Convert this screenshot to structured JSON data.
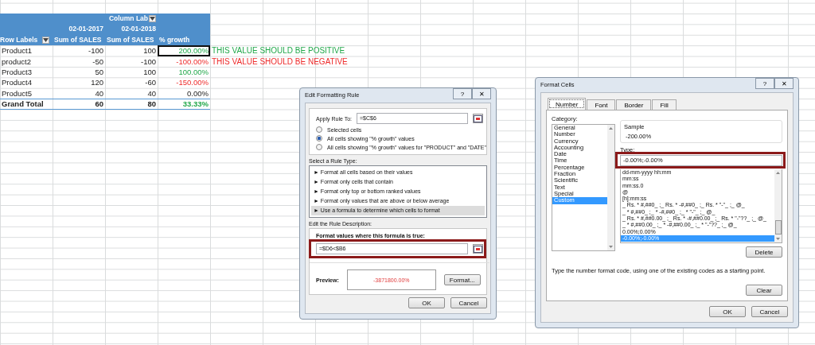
{
  "pivot": {
    "column_labels": "Column Lab",
    "dates": [
      "02-01-2017",
      "02-01-2018"
    ],
    "headers": [
      "Row Labels",
      "Sum of SALES",
      "Sum of SALES",
      "% growth"
    ],
    "rows": [
      {
        "label": "Product1",
        "sales_1": "-100",
        "sales_2": "100",
        "growth": "200.00%",
        "kind": "positive",
        "active": true,
        "note": {
          "text": "THIS VALUE SHOULD BE POSITIVE",
          "color": "#21a84a"
        }
      },
      {
        "label": "product2",
        "sales_1": "-50",
        "sales_2": "-100",
        "growth": "-100.00%",
        "kind": "negative",
        "active": false,
        "note": {
          "text": "THIS VALUE SHOULD BE NEGATIVE",
          "color": "#ee2a2a"
        }
      },
      {
        "label": "Product3",
        "sales_1": "50",
        "sales_2": "100",
        "growth": "100.00%",
        "kind": "positive",
        "active": false
      },
      {
        "label": "Product4",
        "sales_1": "120",
        "sales_2": "-60",
        "growth": "-150.00%",
        "kind": "negative",
        "active": false
      },
      {
        "label": "Product5",
        "sales_1": "40",
        "sales_2": "40",
        "growth": "0.00%",
        "kind": "zero",
        "active": false
      }
    ],
    "total": {
      "label": "Grand Total",
      "sales_1": "60",
      "sales_2": "80",
      "growth": "33.33%",
      "kind": "positive"
    }
  },
  "edit_rule_dialog": {
    "title": "Edit Formatting Rule",
    "title_buttons": [
      "?",
      "✕"
    ],
    "apply_label": "Apply Rule To:",
    "apply_value": "=$C$6",
    "scope_options": [
      {
        "label": "Selected cells",
        "selected": false
      },
      {
        "label": "All cells showing \"% growth\" values",
        "selected": true
      },
      {
        "label": "All cells showing \"% growth\" values for \"PRODUCT\" and \"DATE\"",
        "selected": false
      }
    ],
    "rule_type_label": "Select a Rule Type:",
    "rule_types": [
      {
        "label": "► Format all cells based on their values",
        "selected": false
      },
      {
        "label": "► Format only cells that contain",
        "selected": false
      },
      {
        "label": "► Format only top or bottom ranked values",
        "selected": false
      },
      {
        "label": "► Format only values that are above or below average",
        "selected": false
      },
      {
        "label": "► Use a formula to determine which cells to format",
        "selected": true
      }
    ],
    "description_label": "Edit the Rule Description:",
    "formula_label": "Format values where this formula is true:",
    "formula": "=$D6<$B6",
    "preview_label": "Preview:",
    "preview_value": "-3871800.00%",
    "format_button": "Format...",
    "buttons": [
      "OK",
      "Cancel"
    ]
  },
  "format_cells_dialog": {
    "title": "Format Cells",
    "title_buttons": [
      "?",
      "✕"
    ],
    "tabs": [
      {
        "label": "Number",
        "selected": true
      },
      {
        "label": "Font",
        "selected": false
      },
      {
        "label": "Border",
        "selected": false
      },
      {
        "label": "Fill",
        "selected": false
      }
    ],
    "category_label": "Category:",
    "categories": [
      {
        "label": "General",
        "selected": false
      },
      {
        "label": "Number",
        "selected": false
      },
      {
        "label": "Currency",
        "selected": false
      },
      {
        "label": "Accounting",
        "selected": false
      },
      {
        "label": "Date",
        "selected": false
      },
      {
        "label": "Time",
        "selected": false
      },
      {
        "label": "Percentage",
        "selected": false
      },
      {
        "label": "Fraction",
        "selected": false
      },
      {
        "label": "Scientific",
        "selected": false
      },
      {
        "label": "Text",
        "selected": false
      },
      {
        "label": "Special",
        "selected": false
      },
      {
        "label": "Custom",
        "selected": true
      }
    ],
    "sample_label": "Sample",
    "sample_value": "-200.00%",
    "type_label": "Type:",
    "type_value": "-0.00%;-0.00%",
    "types": [
      {
        "label": "dd-mm-yyyy hh:mm",
        "selected": false
      },
      {
        "label": "mm:ss",
        "selected": false
      },
      {
        "label": "mm:ss.0",
        "selected": false
      },
      {
        "label": "@",
        "selected": false
      },
      {
        "label": "[h]:mm:ss",
        "selected": false
      },
      {
        "label": "_ Rs. * #,##0_ ;_ Rs. * -#,##0_ ;_ Rs. * \"-\"_ ;_ @_",
        "selected": false
      },
      {
        "label": "_ * #,##0_ ;_ * -#,##0_ ;_ * \"-\"_ ;_ @_",
        "selected": false
      },
      {
        "label": "_ Rs. * #,##0.00_ ;_ Rs. * -#,##0.00_ ;_ Rs. * \"-\"??_ ;_ @_",
        "selected": false
      },
      {
        "label": "_ * #,##0.00_ ;_ * -#,##0.00_ ;_ * \"-\"??_ ;_ @_",
        "selected": false
      },
      {
        "label": "0.00%;0.00%",
        "selected": false
      },
      {
        "label": "-0.00%;-0.00%",
        "selected": true
      }
    ],
    "delete_button": "Delete",
    "description": "Type the number format code, using one of the existing codes as a starting point.",
    "clear_button": "Clear",
    "buttons": [
      "OK",
      "Cancel"
    ]
  }
}
